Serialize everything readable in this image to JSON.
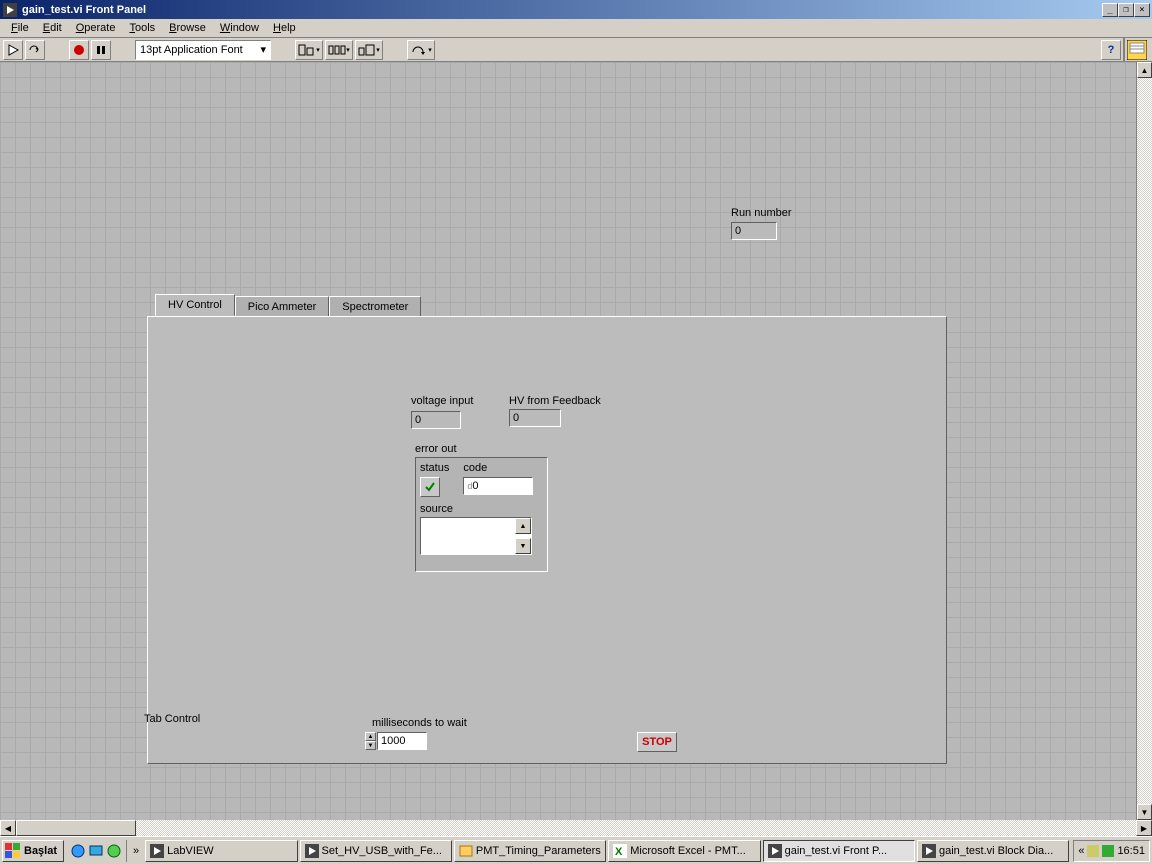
{
  "window": {
    "title": "gain_test.vi Front Panel"
  },
  "menu": [
    "File",
    "Edit",
    "Operate",
    "Tools",
    "Browse",
    "Window",
    "Help"
  ],
  "toolbar": {
    "font": "13pt Application Font"
  },
  "run_number": {
    "label": "Run number",
    "value": "0"
  },
  "tabs": {
    "active": "HV Control",
    "t1": "HV Control",
    "t2": "Pico Ammeter",
    "t3": "Spectrometer"
  },
  "voltage_input": {
    "label": "voltage  input",
    "value": "0"
  },
  "hv_feedback": {
    "label": "HV from Feedback",
    "value": "0"
  },
  "error_out": {
    "label": "error out",
    "status_label": "status",
    "code_label": "code",
    "code_value": "0",
    "source_label": "source",
    "source_value": ""
  },
  "tab_control_label": "Tab Control",
  "ms_wait": {
    "label": "milliseconds to wait",
    "value": "1000"
  },
  "stop": {
    "label": "STOP"
  },
  "taskbar": {
    "start": "Başlat",
    "items": [
      "LabVIEW",
      "Set_HV_USB_with_Fe...",
      "PMT_Timing_Parameters",
      "Microsoft Excel - PMT...",
      "gain_test.vi Front P...",
      "gain_test.vi Block Dia..."
    ],
    "time": "16:51"
  }
}
